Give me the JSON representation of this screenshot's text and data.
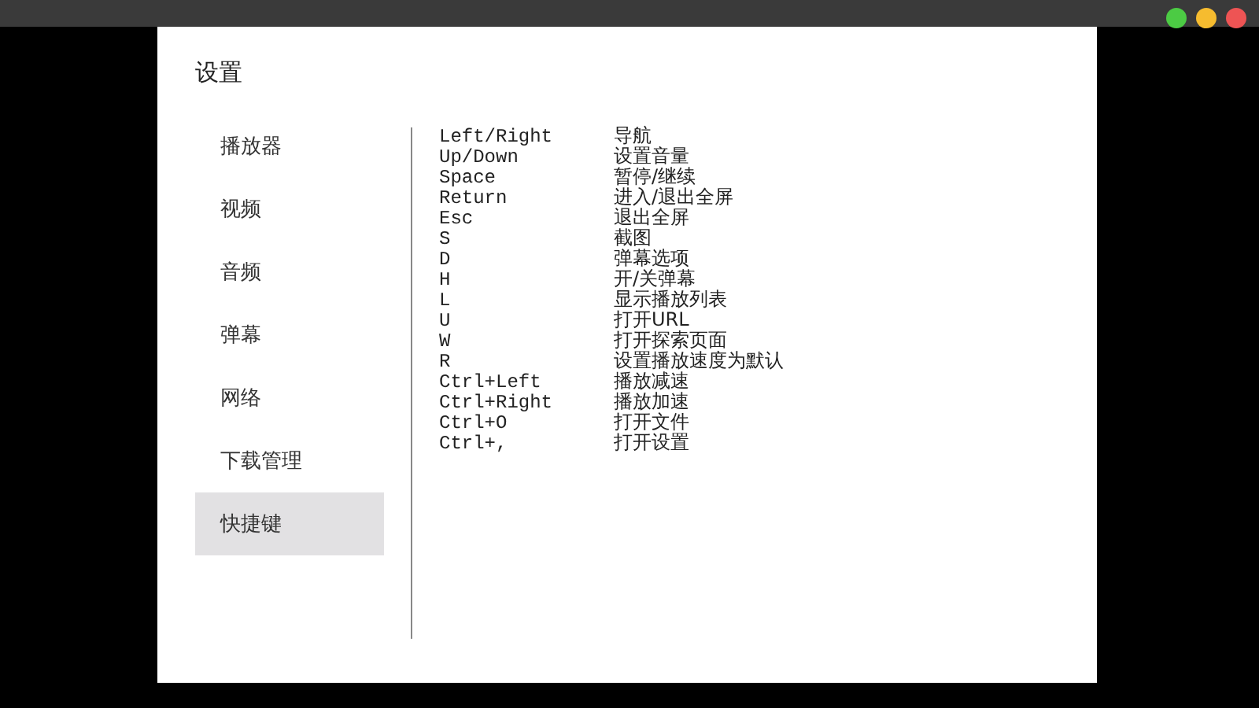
{
  "dialog": {
    "title": "设置"
  },
  "sidebar": {
    "items": [
      {
        "label": "播放器",
        "selected": false
      },
      {
        "label": "视频",
        "selected": false
      },
      {
        "label": "音频",
        "selected": false
      },
      {
        "label": "弹幕",
        "selected": false
      },
      {
        "label": "网络",
        "selected": false
      },
      {
        "label": "下载管理",
        "selected": false
      },
      {
        "label": "快捷键",
        "selected": true
      }
    ]
  },
  "shortcuts": [
    {
      "key": "Left/Right",
      "action": "导航"
    },
    {
      "key": "Up/Down",
      "action": "设置音量"
    },
    {
      "key": "Space",
      "action": "暂停/继续"
    },
    {
      "key": "Return",
      "action": "进入/退出全屏"
    },
    {
      "key": "Esc",
      "action": "退出全屏"
    },
    {
      "key": "S",
      "action": "截图"
    },
    {
      "key": "D",
      "action": "弹幕选项"
    },
    {
      "key": "H",
      "action": "开/关弹幕"
    },
    {
      "key": "L",
      "action": "显示播放列表"
    },
    {
      "key": "U",
      "action": "打开URL"
    },
    {
      "key": "W",
      "action": "打开探索页面"
    },
    {
      "key": "R",
      "action": "设置播放速度为默认"
    },
    {
      "key": "Ctrl+Left",
      "action": "播放减速"
    },
    {
      "key": "Ctrl+Right",
      "action": "播放加速"
    },
    {
      "key": "Ctrl+O",
      "action": "打开文件"
    },
    {
      "key": "Ctrl+,",
      "action": "打开设置"
    }
  ]
}
